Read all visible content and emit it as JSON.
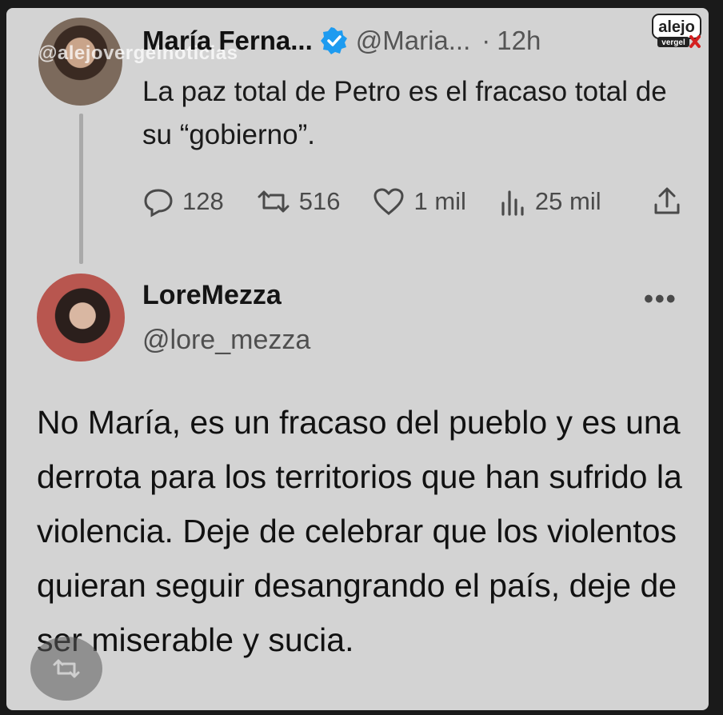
{
  "watermark": {
    "text": "@alejovergelnoticias"
  },
  "brand": {
    "line1": "alejo",
    "line2": "vergel"
  },
  "parent_tweet": {
    "author_name": "María Ferna...",
    "handle": "@Maria...",
    "separator": "·",
    "time": "12h",
    "text": "La paz total de Petro es el fracaso total de su “gobierno”.",
    "replies": "128",
    "retweets": "516",
    "likes": "1 mil",
    "views": "25 mil"
  },
  "reply_tweet": {
    "author_name": "LoreMezza",
    "handle": "@lore_mezza",
    "more_label": "•••",
    "text": "No María, es un fracaso del pueblo y es una derrota para los territorios que han sufrido la violencia. Deje de celebrar que los violentos quieran seguir desangrando el país, deje de ser miserable y sucia."
  },
  "colors": {
    "card": "#d3d3d3",
    "verified": "#1d9bf0",
    "background": "#1a1a1a"
  },
  "icons": [
    "verified-badge-icon",
    "reply-icon",
    "retweet-icon",
    "like-icon",
    "views-icon",
    "share-icon",
    "more-icon",
    "repost-icon"
  ]
}
